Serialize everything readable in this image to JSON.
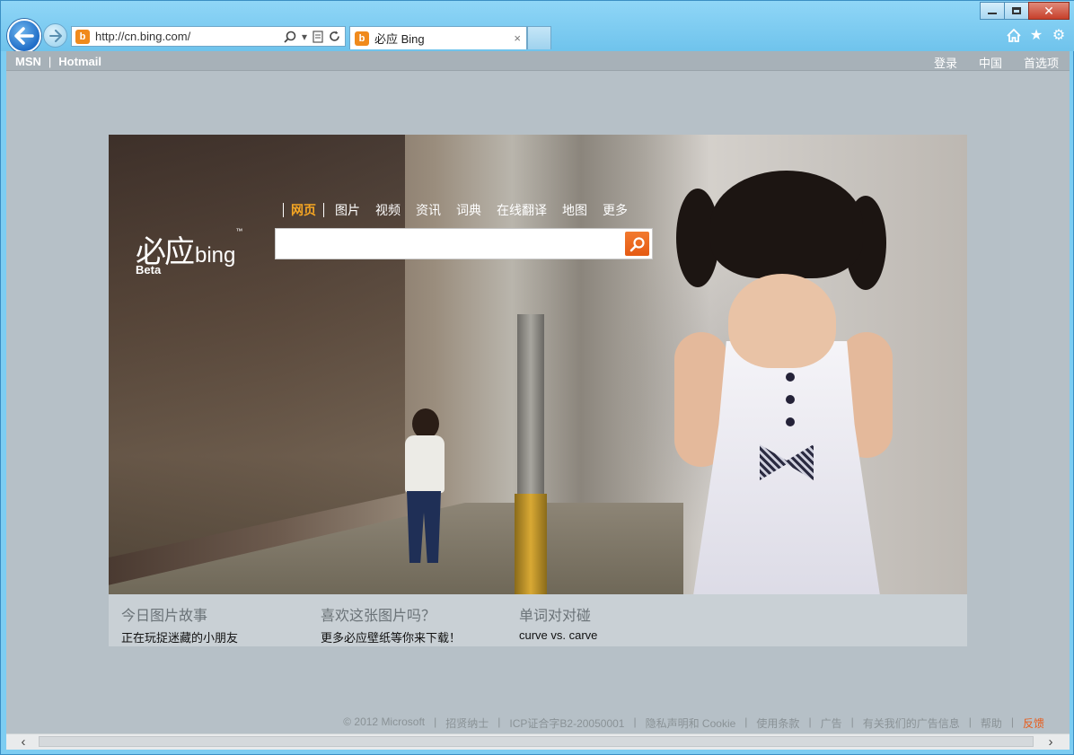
{
  "browser": {
    "address_url": "http://cn.bing.com/",
    "tab_title": "必应 Bing",
    "tab_close": "×",
    "favicon_letter": "b"
  },
  "topbar": {
    "left": [
      "MSN",
      "Hotmail"
    ],
    "separator": "|",
    "right": [
      "登录",
      "中国",
      "首选项"
    ]
  },
  "logo": {
    "cn": "必应",
    "en": "bing",
    "tm": "™",
    "beta": "Beta"
  },
  "scopes": [
    "网页",
    "图片",
    "视频",
    "资讯",
    "词典",
    "在线翻译",
    "地图",
    "更多"
  ],
  "search": {
    "value": "",
    "placeholder": ""
  },
  "info": [
    {
      "heading": "今日图片故事",
      "sub": "正在玩捉迷藏的小朋友"
    },
    {
      "heading": "喜欢这张图片吗？",
      "sub": "更多必应壁纸等你来下载！"
    },
    {
      "heading": "单词对对碰",
      "sub": "curve vs. carve"
    }
  ],
  "footer": {
    "links": [
      "© 2012 Microsoft",
      "招贤纳士",
      "ICP证合字B2-20050001",
      "隐私声明和 Cookie",
      "使用条款",
      "广告",
      "有关我们的广告信息",
      "帮助"
    ],
    "separator": "|",
    "feedback": "反馈"
  },
  "colors": {
    "accent": "#f6a623",
    "search_button": "#e55a13",
    "feedback": "#e85c1b"
  }
}
